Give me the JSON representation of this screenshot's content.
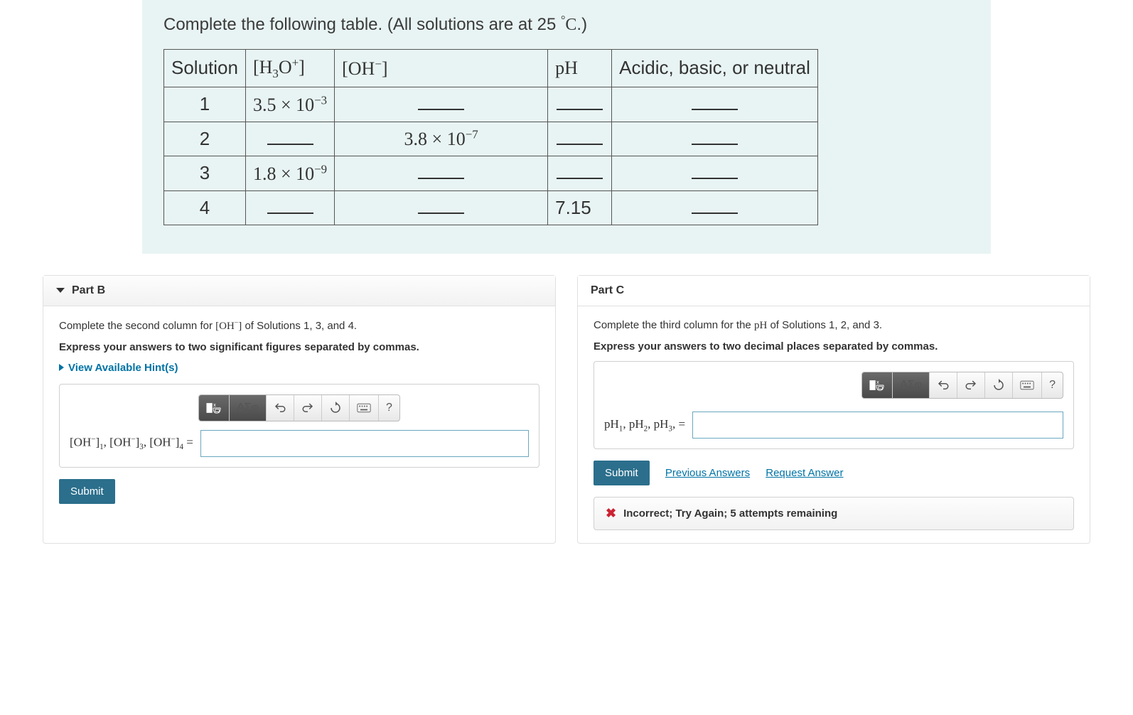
{
  "prompt": {
    "text_before": "Complete the following table. (All solutions are at 25 ",
    "degree": "°",
    "unit": "C",
    "text_after": ".)"
  },
  "table": {
    "headers": {
      "solution": "Solution",
      "h3o": "[H₃O⁺]",
      "oh": "[OH⁻]",
      "ph": "pH",
      "classify": "Acidic, basic, or neutral"
    },
    "rows": [
      {
        "n": "1",
        "h3o": "3.5 × 10⁻³",
        "oh": "",
        "ph": "",
        "classify": ""
      },
      {
        "n": "2",
        "h3o": "",
        "oh": "3.8 × 10⁻⁷",
        "ph": "",
        "classify": ""
      },
      {
        "n": "3",
        "h3o": "1.8 × 10⁻⁹",
        "oh": "",
        "ph": "",
        "classify": ""
      },
      {
        "n": "4",
        "h3o": "",
        "oh": "",
        "ph": "7.15",
        "classify": ""
      }
    ]
  },
  "partB": {
    "title": "Part B",
    "instruction_pre": "Complete the second column for ",
    "instruction_var": "[OH⁻]",
    "instruction_post": " of Solutions 1, 3, and  4.",
    "express": "Express your answers to two significant figures separated by commas.",
    "hints": "View Available Hint(s)",
    "label": "[OH⁻]₁, [OH⁻]₃, [OH⁻]₄ =",
    "submit": "Submit"
  },
  "partC": {
    "title": "Part C",
    "instruction_pre": "Complete the third column for the ",
    "instruction_var": "pH",
    "instruction_post": " of Solutions 1,  2, and  3.",
    "express": "Express your answers to two decimal places separated by commas.",
    "label": "pH₁, pH₂, pH₃, =",
    "submit": "Submit",
    "prev": "Previous Answers",
    "request": "Request Answer",
    "feedback": "Incorrect; Try Again; 5 attempts remaining"
  },
  "toolbar": {
    "templates": "templates",
    "symbols": "ΑΣφ",
    "undo": "↶",
    "redo": "↷",
    "reset": "↻",
    "help": "?"
  }
}
